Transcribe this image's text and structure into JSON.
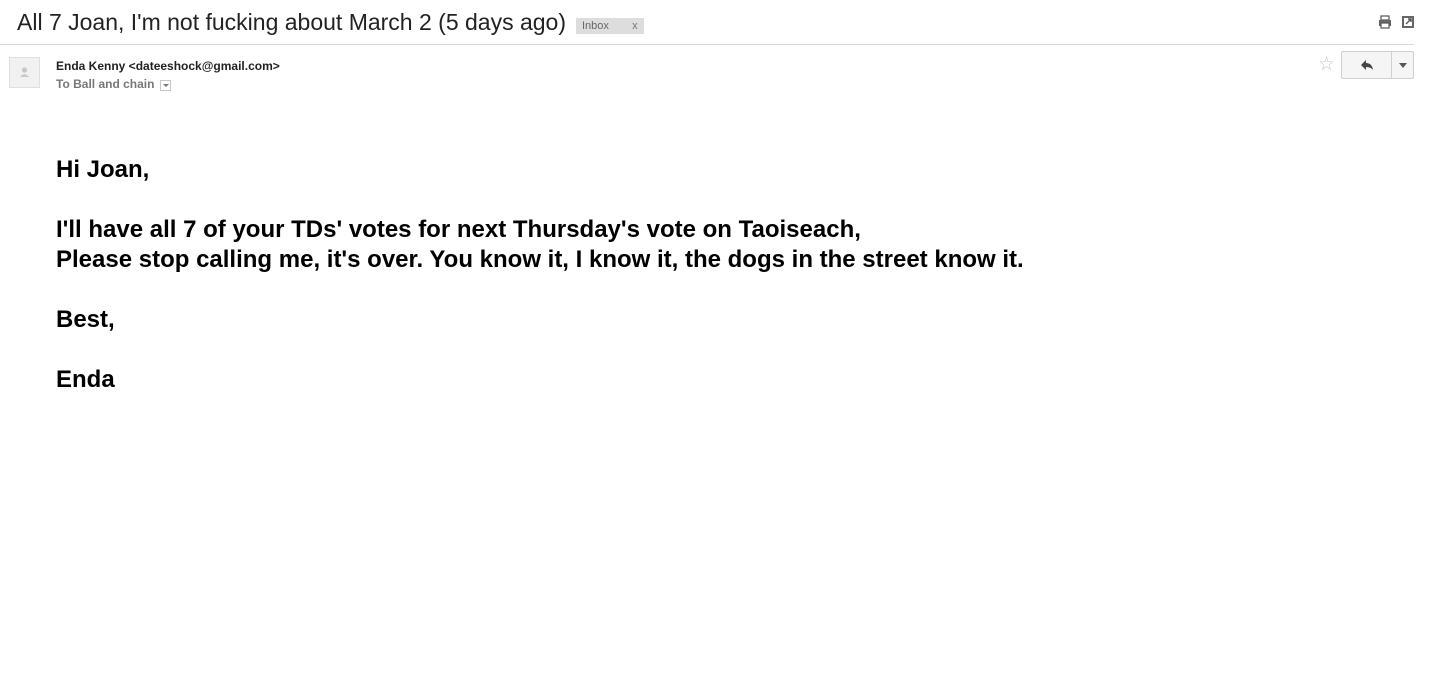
{
  "subject": {
    "title": "All 7 Joan, I'm not fucking about March 2 (5 days ago)",
    "label": "Inbox",
    "label_remove": "x"
  },
  "toolbar": {
    "print_icon": "printer-icon",
    "popout_icon": "new-window-icon"
  },
  "message": {
    "sender": "Enda Kenny <dateeshock@gmail.com>",
    "recipient": "To Ball and chain",
    "star_icon": "star-outline-icon",
    "reply_icon": "reply-arrow-icon",
    "more_icon": "chevron-down-icon",
    "body": {
      "greeting": "Hi Joan,",
      "line1": "I'll have all 7 of your TDs' votes for next Thursday's vote on Taoiseach,",
      "line2": "Please stop calling me, it's over. You know it, I know it, the dogs in the street know it.",
      "signoff": "Best,",
      "signature": "Enda"
    }
  }
}
